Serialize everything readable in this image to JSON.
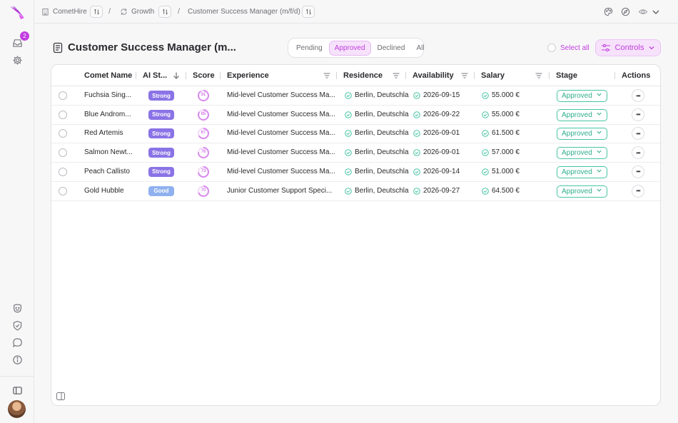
{
  "sidebar": {
    "notification_count": "2",
    "icons": [
      "logo-icon",
      "inbox-icon",
      "gear-icon",
      "smiley-icon",
      "shield-check-icon",
      "chat-icon",
      "info-icon",
      "panel-icon"
    ]
  },
  "breadcrumb": {
    "org": "CometHire",
    "team": "Growth",
    "job": "Customer Success Manager (m/f/d)",
    "separator": "/"
  },
  "header": {
    "title": "Customer Success Manager (m...",
    "tabs": [
      "Pending",
      "Approved",
      "Declined",
      "All"
    ],
    "active_tab": "Approved",
    "select_all": "Select all",
    "controls": "Controls"
  },
  "table": {
    "columns": [
      "Comet Name",
      "AI St...",
      "Score",
      "Experience",
      "Residence",
      "Availability",
      "Salary",
      "Stage",
      "Actions"
    ],
    "rows": [
      {
        "name": "Fuchsia Sing...",
        "ai": "Strong",
        "score": "91",
        "experience": "Mid-level Customer Success Ma...",
        "residence": "Berlin, Deutschla",
        "availability": "2026-09-15",
        "salary": "55.000 €",
        "stage": "Approved"
      },
      {
        "name": "Blue Androm...",
        "ai": "Strong",
        "score": "85",
        "experience": "Mid-level Customer Success Ma...",
        "residence": "Berlin, Deutschla",
        "availability": "2026-09-22",
        "salary": "55.000 €",
        "stage": "Approved"
      },
      {
        "name": "Red Artemis",
        "ai": "Strong",
        "score": "67",
        "experience": "Mid-level Customer Success Ma...",
        "residence": "Berlin, Deutschla",
        "availability": "2026-09-01",
        "salary": "61.500 €",
        "stage": "Approved"
      },
      {
        "name": "Salmon Newt...",
        "ai": "Strong",
        "score": "76",
        "experience": "Mid-level Customer Success Ma...",
        "residence": "Berlin, Deutschla",
        "availability": "2026-09-01",
        "salary": "57.000 €",
        "stage": "Approved"
      },
      {
        "name": "Peach Callisto",
        "ai": "Strong",
        "score": "73",
        "experience": "Mid-level Customer Success Ma...",
        "residence": "Berlin, Deutschla",
        "availability": "2026-09-14",
        "salary": "51.000 €",
        "stage": "Approved"
      },
      {
        "name": "Gold Hubble",
        "ai": "Good",
        "score": "70",
        "experience": "Junior Customer Support Speci...",
        "residence": "Berlin, Deutschla",
        "availability": "2026-09-27",
        "salary": "64.500 €",
        "stage": "Approved"
      }
    ]
  },
  "colors": {
    "accent": "#c23ee0",
    "strong_badge": "#8a73e6",
    "good_badge": "#8fb1ef",
    "approved": "#2fae8d",
    "check": "#47c4a3"
  }
}
